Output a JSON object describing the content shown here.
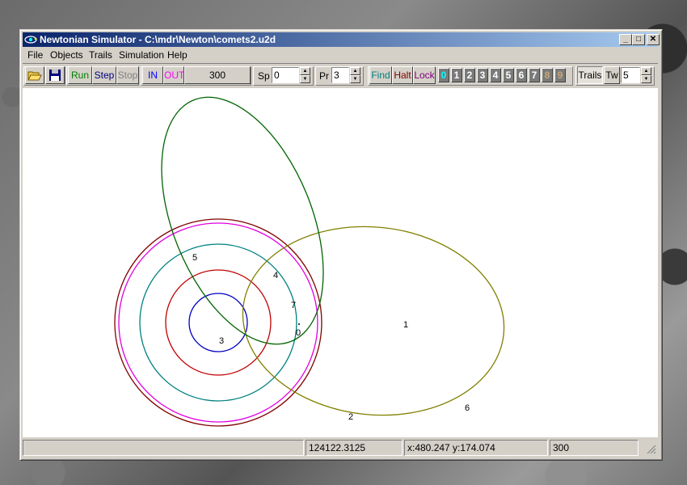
{
  "window": {
    "title": "Newtonian Simulator - C:\\mdr\\Newton\\comets2.u2d",
    "minimize": "_",
    "maximize": "□",
    "close": "✕"
  },
  "menu": [
    "File",
    "Objects",
    "Trails",
    "Simulation",
    "Help"
  ],
  "toolbar": {
    "open_icon": "folder-open-icon",
    "save_icon": "floppy-disk-icon",
    "run": "Run",
    "step": "Step",
    "stop": "Stop",
    "zoom_in": "IN",
    "zoom_out": "OUT",
    "zoom_value": "300",
    "speed_label": "Sp",
    "speed_value": "0",
    "precision_label": "Pr",
    "precision_value": "3",
    "find": "Find",
    "halt": "Halt",
    "lock": "Lock",
    "object_buttons": [
      "0",
      "1",
      "2",
      "3",
      "4",
      "5",
      "6",
      "7",
      "8",
      "9"
    ],
    "trails": "Trails",
    "trail_width_label": "Tw",
    "trail_width_value": "5",
    "colors": {
      "run": "#008000",
      "step": "#000080",
      "stop": "#808080",
      "in": "#0000ff",
      "out": "#ff00ff",
      "find": "#008080",
      "halt": "#800000",
      "lock": "#800080",
      "selected_object": "#00ffff"
    }
  },
  "orbit_labels": {
    "o0": "0",
    "o1": "1",
    "o2": "2",
    "o3": "3",
    "o4": "4",
    "o5": "5",
    "o6": "6",
    "o7": "7"
  },
  "orbit_colors": {
    "o0": "#0000c0",
    "o1": "#800000",
    "o2": "#e000e0",
    "o3": "#008080",
    "o4": "#c00000",
    "o5": "#006400",
    "o6": "#808000",
    "o7": "#000080"
  },
  "status": {
    "time": "124122.3125",
    "coords": "x:480.247 y:174.074",
    "zoom": "300"
  }
}
